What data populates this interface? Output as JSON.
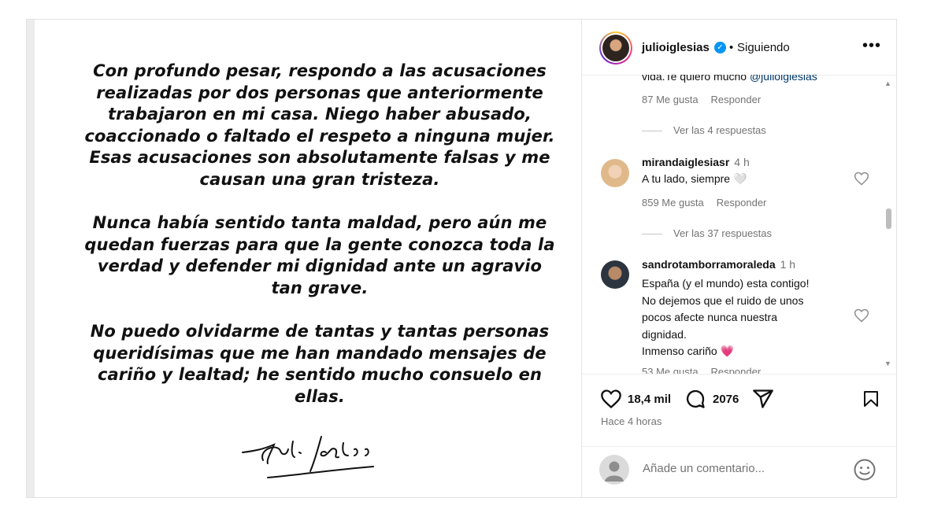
{
  "statement": {
    "paragraphs": [
      "Con profundo pesar, respondo a las acusaciones realizadas por dos personas que anteriormente trabajaron en mi casa. Niego haber abusado, coaccionado o faltado el respeto a ninguna mujer. Esas acusaciones son absolutamente falsas y me causan una gran tristeza.",
      "Nunca había sentido tanta maldad, pero aún me quedan fuerzas para que la gente conozca toda la verdad y defender mi dignidad ante un agravio tan grave.",
      "No puedo olvidarme de tantas y tantas personas queridísimas que me han mandado mensajes de cariño y lealtad; he sentido mucho consuelo en ellas."
    ],
    "signature": "Julio Iglesias"
  },
  "header": {
    "username": "julioiglesias",
    "verified_icon": "verified-badge-icon",
    "separator": "•",
    "follow_status": "Siguiendo",
    "more_icon": "more-options-icon",
    "more_label": "•••"
  },
  "comments": {
    "clipped_text": "vida.Te quiero mucho ",
    "clipped_mention": "@julioiglesias",
    "first_meta": {
      "likes": "87 Me gusta",
      "reply": "Responder"
    },
    "first_replies": "Ver las 4 respuestas",
    "items": [
      {
        "username": "mirandaiglesiasr",
        "time": "4 h",
        "text": "A tu lado, siempre 🤍",
        "likes": "859 Me gusta",
        "reply": "Responder",
        "replies": "Ver las 37 respuestas"
      },
      {
        "username": "sandrotamborramoraleda",
        "time": "1 h",
        "text_lines": [
          "España (y el mundo) esta contigo!",
          "No dejemos que el ruido de unos",
          "pocos afecte nunca nuestra",
          "dignidad.",
          "Inmenso cariño 💗"
        ],
        "likes": "53 Me gusta",
        "reply": "Responder"
      }
    ]
  },
  "actions": {
    "like_icon": "heart-icon",
    "likes_count": "18,4 mil",
    "comment_icon": "comment-bubble-icon",
    "comments_count": "2076",
    "share_icon": "share-paper-plane-icon",
    "save_icon": "bookmark-icon"
  },
  "posted_time": "Hace 4 horas",
  "add_comment": {
    "placeholder": "Añade un comentario...",
    "emoji_icon": "smiley-emoji-icon"
  },
  "colors": {
    "verified": "#0095f6",
    "meta_gray": "#737373",
    "mention": "#00376b",
    "heart_pink": "#e8457a"
  }
}
